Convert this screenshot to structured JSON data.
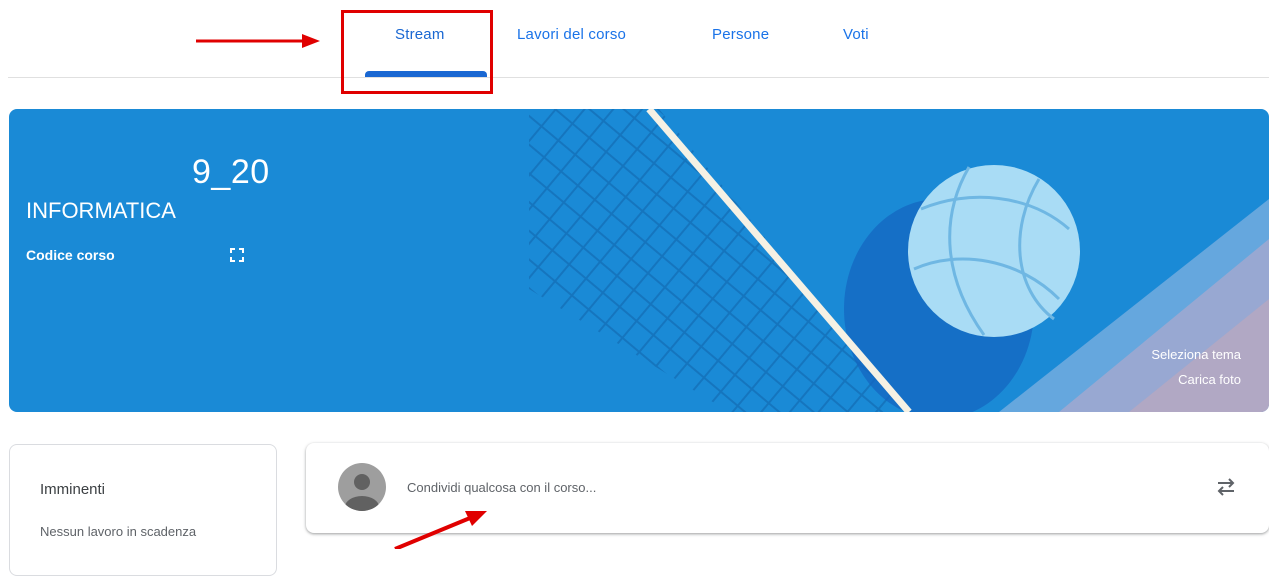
{
  "tabs": [
    {
      "label": "Stream",
      "active": true
    },
    {
      "label": "Lavori del corso",
      "active": false
    },
    {
      "label": "Persone",
      "active": false
    },
    {
      "label": "Voti",
      "active": false
    }
  ],
  "banner": {
    "class_name": "9_20",
    "section": "INFORMATICA",
    "code_label": "Codice corso",
    "select_theme": "Seleziona tema",
    "upload_photo": "Carica foto",
    "background_color": "#1a8ad6",
    "illustration_icon": "volleyball-net-illustration"
  },
  "upcoming": {
    "title": "Imminenti",
    "empty_text": "Nessun lavoro in scadenza"
  },
  "share": {
    "placeholder": "Condividi qualcosa con il corso...",
    "avatar_icon": "default-avatar-icon",
    "action_icon": "repost-icon"
  },
  "colors": {
    "tab_text": "#1a73e8",
    "active_tab": "#1967d2",
    "annotation": "#e00000"
  }
}
